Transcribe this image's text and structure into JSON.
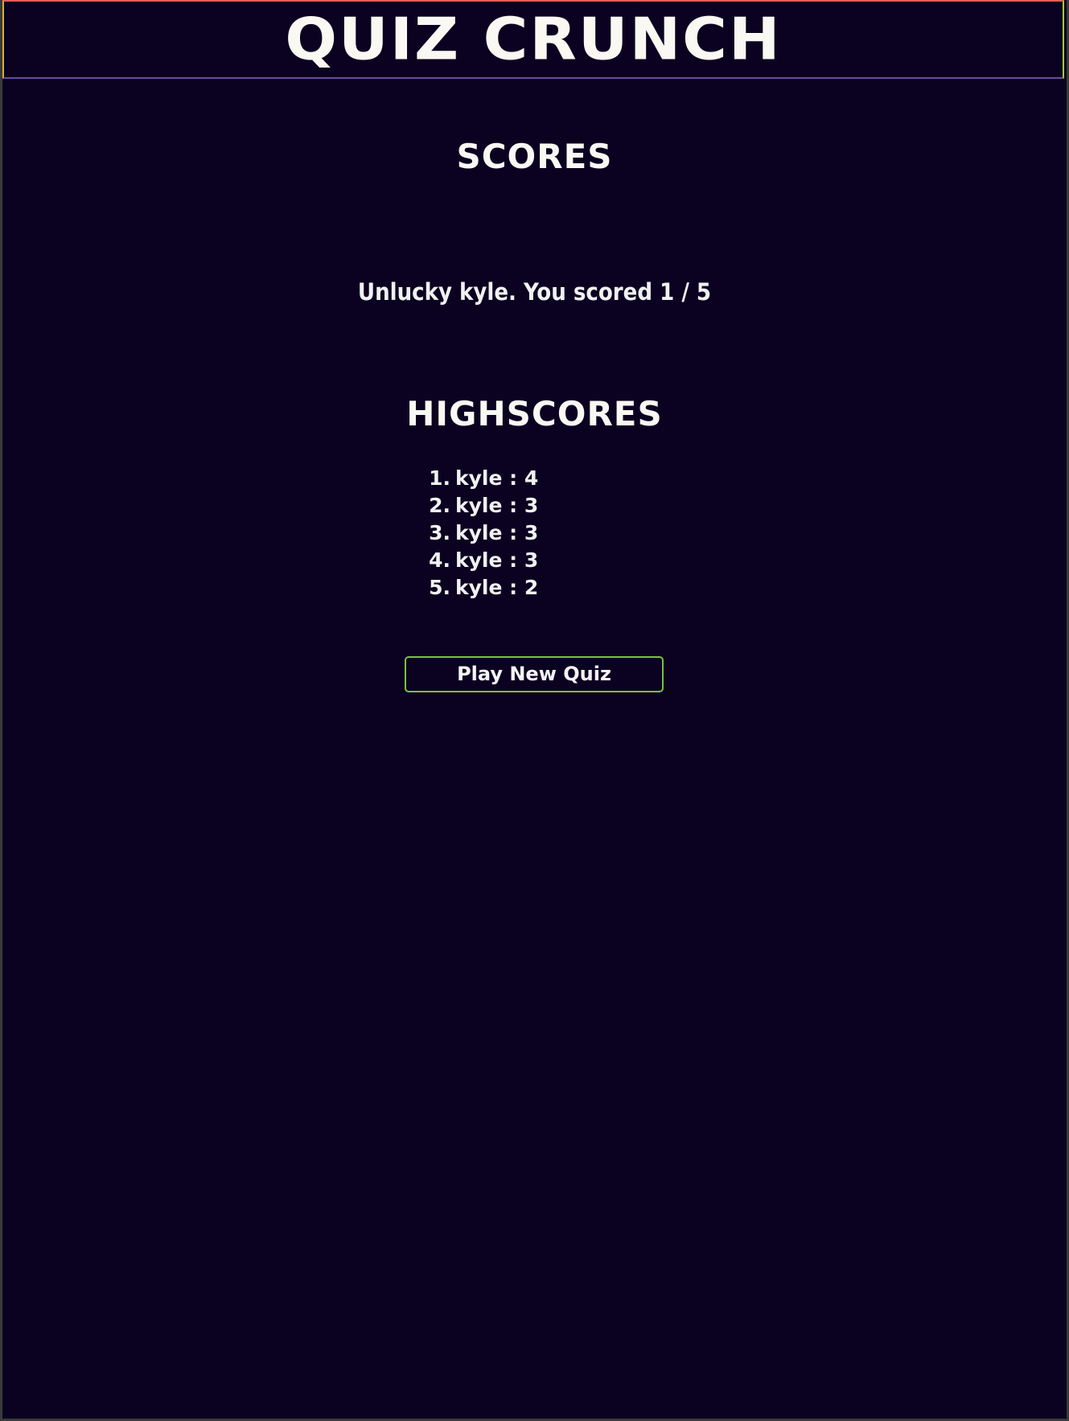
{
  "header": {
    "title": "QUIZ CRUNCH"
  },
  "scores": {
    "title": "SCORES",
    "message": "Unlucky kyle. You scored 1 / 5"
  },
  "highscores": {
    "title": "HIGHSCORES",
    "entries": [
      {
        "rank": "1.",
        "text": "kyle : 4"
      },
      {
        "rank": "2.",
        "text": "kyle : 3"
      },
      {
        "rank": "3.",
        "text": "kyle : 3"
      },
      {
        "rank": "4.",
        "text": "kyle : 3"
      },
      {
        "rank": "5.",
        "text": "kyle : 2"
      }
    ]
  },
  "actions": {
    "play_new_quiz_label": "Play New Quiz"
  },
  "colors": {
    "background": "#0b0221",
    "text": "#faf8f2",
    "button_border": "#7cc23a",
    "header_border_top": "#e0605a",
    "header_border_left": "#d8b02a",
    "header_border_right": "#a7c93a",
    "header_border_bottom": "#6a4a9a"
  }
}
